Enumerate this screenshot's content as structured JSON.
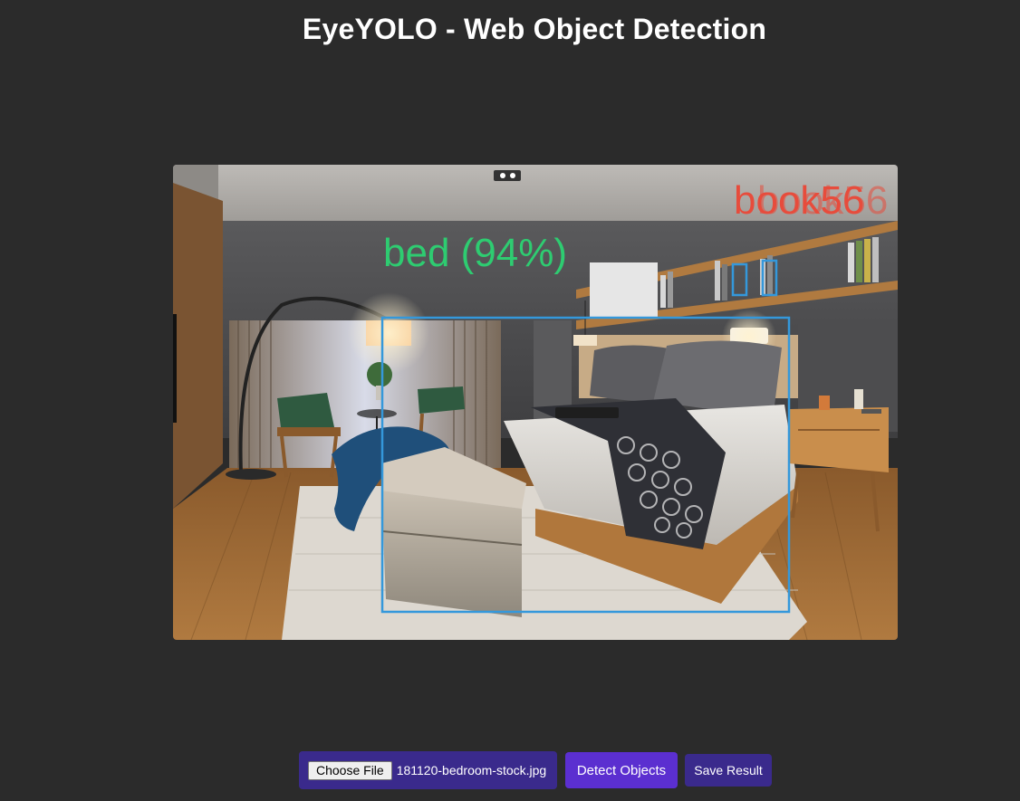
{
  "header": {
    "title": "EyeYOLO - Web Object Detection"
  },
  "result_image": {
    "alt": "Detection result",
    "detections": [
      {
        "label_text": "bed (94%)",
        "class": "bed",
        "confidence_pct": 94,
        "color": "#2ecc71",
        "box_color": "#3498db"
      },
      {
        "label_text": "book56",
        "class": "book",
        "color": "#e74c3c",
        "box_color": "#3498db"
      }
    ]
  },
  "controls": {
    "choose_file_label": "Choose File",
    "file_name": "181120-bedroom-stock.jpg",
    "detect_label": "Detect Objects",
    "save_label": "Save Result"
  },
  "colors": {
    "background": "#2b2b2b",
    "primary_button": "#5b2fd0",
    "secondary_button": "#3a2a8c"
  }
}
